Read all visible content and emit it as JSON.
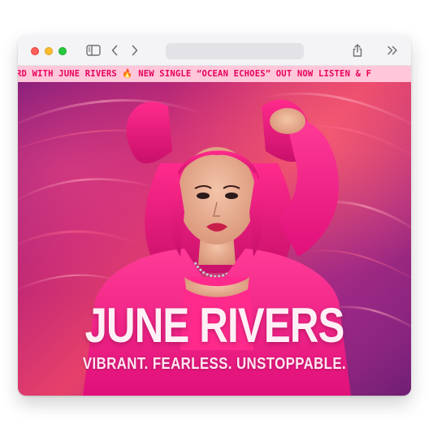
{
  "browser": {
    "address_bar_text": "",
    "icons": {
      "sidebar": "sidebar-icon",
      "back": "chevron-left-icon",
      "forward": "chevron-right-icon",
      "share": "share-icon",
      "more": "double-chevron-right-icon"
    },
    "traffic_light_colors": {
      "close": "#ff5f57",
      "minimize": "#febc2e",
      "zoom": "#28c840"
    }
  },
  "ticker": {
    "text": "RD WITH JUNE RIVERS 🔥 NEW SINGLE “OCEAN ECHOES” OUT NOW LISTEN & F",
    "background": "#ffc7d9",
    "color": "#e8005d"
  },
  "hero": {
    "title": "JUNE RIVERS",
    "tagline": "VIBRANT. FEARLESS. UNSTOPPABLE.",
    "image": "portrait of artist with pink hair in pink jacket",
    "accent_color": "#ff1f8a"
  }
}
